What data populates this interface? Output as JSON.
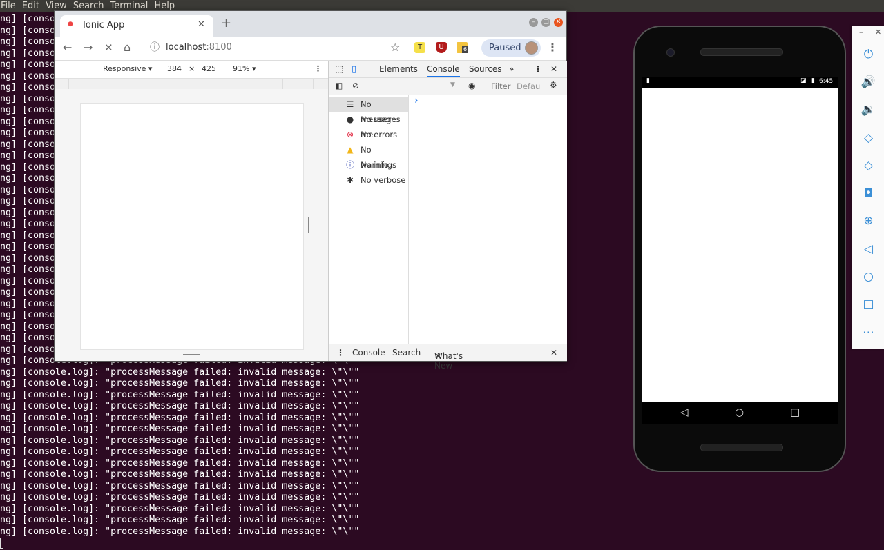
{
  "terminal": {
    "menu": [
      "File",
      "Edit",
      "View",
      "Search",
      "Terminal",
      "Help"
    ],
    "hidden_line_prefix": "ng] [conso",
    "log_line": "ng] [console.log]: \"processMessage failed: invalid message: \\\"\\\"\""
  },
  "chrome": {
    "tab_title": "Ionic App",
    "tab_close": "✕",
    "new_tab": "+",
    "url_host": "localhost",
    "url_port": ":8100",
    "paused_label": "Paused",
    "ext_badge": "6",
    "device_toolbar": {
      "device": "Responsive ▾",
      "width": "384",
      "times": "×",
      "height": "425",
      "zoom": "91% ▾"
    }
  },
  "devtools": {
    "tabs": [
      "Elements",
      "Console",
      "Sources"
    ],
    "more": "»",
    "filter_placeholder": "Filter",
    "levels_placeholder": "Defau",
    "sidebar": [
      {
        "label": "No messages",
        "icon": "list-icon"
      },
      {
        "label": "No user me…",
        "icon": "user-icon"
      },
      {
        "label": "No errors",
        "icon": "error-icon"
      },
      {
        "label": "No warnings",
        "icon": "warning-icon"
      },
      {
        "label": "No info",
        "icon": "info-icon"
      },
      {
        "label": "No verbose",
        "icon": "bug-icon"
      }
    ],
    "prompt": "›",
    "drawer_tabs": [
      "Console",
      "Search",
      "What's New"
    ]
  },
  "emulator": {
    "time": "6:45",
    "colors": {
      "accent": "#3b8fd6",
      "terminal_bg": "#2c0a22"
    }
  }
}
